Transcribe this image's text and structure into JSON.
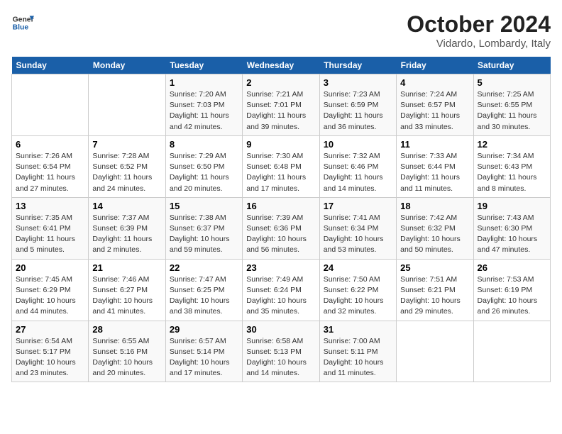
{
  "header": {
    "logo_line1": "General",
    "logo_line2": "Blue",
    "title": "October 2024",
    "subtitle": "Vidardo, Lombardy, Italy"
  },
  "weekdays": [
    "Sunday",
    "Monday",
    "Tuesday",
    "Wednesday",
    "Thursday",
    "Friday",
    "Saturday"
  ],
  "weeks": [
    [
      {
        "day": "",
        "detail": ""
      },
      {
        "day": "",
        "detail": ""
      },
      {
        "day": "1",
        "detail": "Sunrise: 7:20 AM\nSunset: 7:03 PM\nDaylight: 11 hours and 42 minutes."
      },
      {
        "day": "2",
        "detail": "Sunrise: 7:21 AM\nSunset: 7:01 PM\nDaylight: 11 hours and 39 minutes."
      },
      {
        "day": "3",
        "detail": "Sunrise: 7:23 AM\nSunset: 6:59 PM\nDaylight: 11 hours and 36 minutes."
      },
      {
        "day": "4",
        "detail": "Sunrise: 7:24 AM\nSunset: 6:57 PM\nDaylight: 11 hours and 33 minutes."
      },
      {
        "day": "5",
        "detail": "Sunrise: 7:25 AM\nSunset: 6:55 PM\nDaylight: 11 hours and 30 minutes."
      }
    ],
    [
      {
        "day": "6",
        "detail": "Sunrise: 7:26 AM\nSunset: 6:54 PM\nDaylight: 11 hours and 27 minutes."
      },
      {
        "day": "7",
        "detail": "Sunrise: 7:28 AM\nSunset: 6:52 PM\nDaylight: 11 hours and 24 minutes."
      },
      {
        "day": "8",
        "detail": "Sunrise: 7:29 AM\nSunset: 6:50 PM\nDaylight: 11 hours and 20 minutes."
      },
      {
        "day": "9",
        "detail": "Sunrise: 7:30 AM\nSunset: 6:48 PM\nDaylight: 11 hours and 17 minutes."
      },
      {
        "day": "10",
        "detail": "Sunrise: 7:32 AM\nSunset: 6:46 PM\nDaylight: 11 hours and 14 minutes."
      },
      {
        "day": "11",
        "detail": "Sunrise: 7:33 AM\nSunset: 6:44 PM\nDaylight: 11 hours and 11 minutes."
      },
      {
        "day": "12",
        "detail": "Sunrise: 7:34 AM\nSunset: 6:43 PM\nDaylight: 11 hours and 8 minutes."
      }
    ],
    [
      {
        "day": "13",
        "detail": "Sunrise: 7:35 AM\nSunset: 6:41 PM\nDaylight: 11 hours and 5 minutes."
      },
      {
        "day": "14",
        "detail": "Sunrise: 7:37 AM\nSunset: 6:39 PM\nDaylight: 11 hours and 2 minutes."
      },
      {
        "day": "15",
        "detail": "Sunrise: 7:38 AM\nSunset: 6:37 PM\nDaylight: 10 hours and 59 minutes."
      },
      {
        "day": "16",
        "detail": "Sunrise: 7:39 AM\nSunset: 6:36 PM\nDaylight: 10 hours and 56 minutes."
      },
      {
        "day": "17",
        "detail": "Sunrise: 7:41 AM\nSunset: 6:34 PM\nDaylight: 10 hours and 53 minutes."
      },
      {
        "day": "18",
        "detail": "Sunrise: 7:42 AM\nSunset: 6:32 PM\nDaylight: 10 hours and 50 minutes."
      },
      {
        "day": "19",
        "detail": "Sunrise: 7:43 AM\nSunset: 6:30 PM\nDaylight: 10 hours and 47 minutes."
      }
    ],
    [
      {
        "day": "20",
        "detail": "Sunrise: 7:45 AM\nSunset: 6:29 PM\nDaylight: 10 hours and 44 minutes."
      },
      {
        "day": "21",
        "detail": "Sunrise: 7:46 AM\nSunset: 6:27 PM\nDaylight: 10 hours and 41 minutes."
      },
      {
        "day": "22",
        "detail": "Sunrise: 7:47 AM\nSunset: 6:25 PM\nDaylight: 10 hours and 38 minutes."
      },
      {
        "day": "23",
        "detail": "Sunrise: 7:49 AM\nSunset: 6:24 PM\nDaylight: 10 hours and 35 minutes."
      },
      {
        "day": "24",
        "detail": "Sunrise: 7:50 AM\nSunset: 6:22 PM\nDaylight: 10 hours and 32 minutes."
      },
      {
        "day": "25",
        "detail": "Sunrise: 7:51 AM\nSunset: 6:21 PM\nDaylight: 10 hours and 29 minutes."
      },
      {
        "day": "26",
        "detail": "Sunrise: 7:53 AM\nSunset: 6:19 PM\nDaylight: 10 hours and 26 minutes."
      }
    ],
    [
      {
        "day": "27",
        "detail": "Sunrise: 6:54 AM\nSunset: 5:17 PM\nDaylight: 10 hours and 23 minutes."
      },
      {
        "day": "28",
        "detail": "Sunrise: 6:55 AM\nSunset: 5:16 PM\nDaylight: 10 hours and 20 minutes."
      },
      {
        "day": "29",
        "detail": "Sunrise: 6:57 AM\nSunset: 5:14 PM\nDaylight: 10 hours and 17 minutes."
      },
      {
        "day": "30",
        "detail": "Sunrise: 6:58 AM\nSunset: 5:13 PM\nDaylight: 10 hours and 14 minutes."
      },
      {
        "day": "31",
        "detail": "Sunrise: 7:00 AM\nSunset: 5:11 PM\nDaylight: 10 hours and 11 minutes."
      },
      {
        "day": "",
        "detail": ""
      },
      {
        "day": "",
        "detail": ""
      }
    ]
  ]
}
